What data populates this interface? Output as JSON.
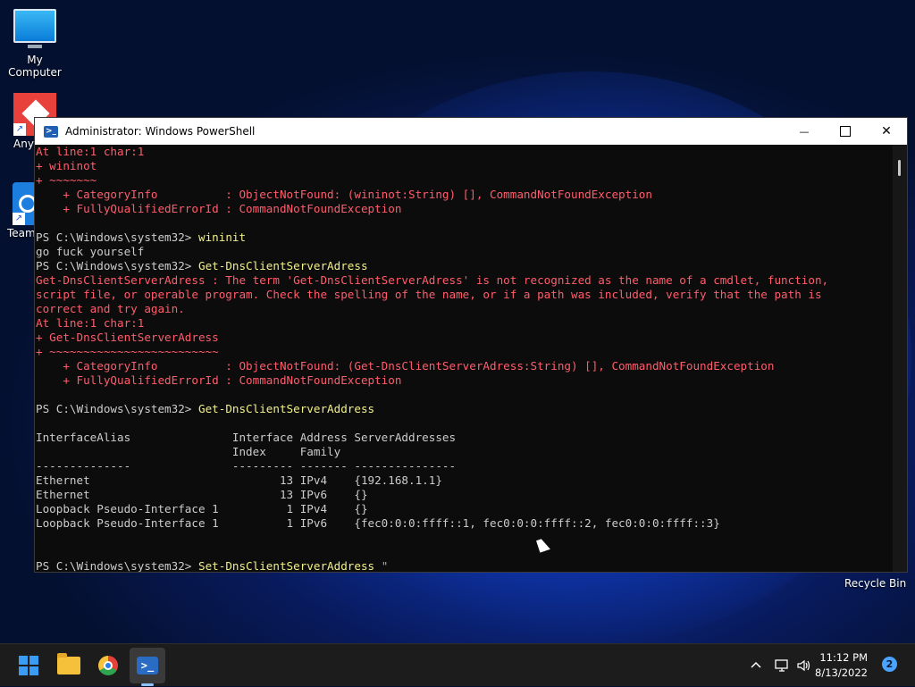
{
  "desktop": {
    "icons": [
      {
        "label": "My Computer"
      },
      {
        "label": "Any"
      },
      {
        "label": "Team"
      }
    ],
    "recycle_bin": "Recycle Bin"
  },
  "window": {
    "title": "Administrator: Windows PowerShell",
    "controls": {
      "minimize": "—",
      "close": "✕"
    }
  },
  "console": {
    "lines": [
      {
        "text": "At line:1 char:1",
        "style": "err"
      },
      {
        "text": "+ wininot",
        "style": "err"
      },
      {
        "text": "+ ~~~~~~~",
        "style": "err"
      },
      {
        "text": "    + CategoryInfo          : ObjectNotFound: (wininot:String) [], CommandNotFoundException",
        "style": "err"
      },
      {
        "text": "    + FullyQualifiedErrorId : CommandNotFoundException",
        "style": "err"
      },
      {
        "text": "",
        "style": "out"
      },
      {
        "prompt": "PS C:\\Windows\\system32> ",
        "cmd": "wininit"
      },
      {
        "text": "go fuck yourself",
        "style": "out"
      },
      {
        "prompt": "PS C:\\Windows\\system32> ",
        "cmd": "Get-DnsClientServerAdress"
      },
      {
        "text": "Get-DnsClientServerAdress : The term 'Get-DnsClientServerAdress' is not recognized as the name of a cmdlet, function,",
        "style": "err"
      },
      {
        "text": "script file, or operable program. Check the spelling of the name, or if a path was included, verify that the path is",
        "style": "err"
      },
      {
        "text": "correct and try again.",
        "style": "err"
      },
      {
        "text": "At line:1 char:1",
        "style": "err"
      },
      {
        "text": "+ Get-DnsClientServerAdress",
        "style": "err"
      },
      {
        "text": "+ ~~~~~~~~~~~~~~~~~~~~~~~~~",
        "style": "err"
      },
      {
        "text": "    + CategoryInfo          : ObjectNotFound: (Get-DnsClientServerAdress:String) [], CommandNotFoundException",
        "style": "err"
      },
      {
        "text": "    + FullyQualifiedErrorId : CommandNotFoundException",
        "style": "err"
      },
      {
        "text": "",
        "style": "out"
      },
      {
        "prompt": "PS C:\\Windows\\system32> ",
        "cmd": "Get-DnsClientServerAddress"
      },
      {
        "text": "",
        "style": "out"
      },
      {
        "text": "InterfaceAlias               Interface Address ServerAddresses",
        "style": "out"
      },
      {
        "text": "                             Index     Family",
        "style": "out"
      },
      {
        "text": "--------------               --------- ------- ---------------",
        "style": "out"
      },
      {
        "text": "Ethernet                            13 IPv4    {192.168.1.1}",
        "style": "out"
      },
      {
        "text": "Ethernet                            13 IPv6    {}",
        "style": "out"
      },
      {
        "text": "Loopback Pseudo-Interface 1          1 IPv4    {}",
        "style": "out"
      },
      {
        "text": "Loopback Pseudo-Interface 1          1 IPv6    {fec0:0:0:ffff::1, fec0:0:0:ffff::2, fec0:0:0:ffff::3}",
        "style": "out"
      },
      {
        "text": "",
        "style": "out"
      },
      {
        "text": "",
        "style": "out"
      },
      {
        "prompt": "PS C:\\Windows\\system32> ",
        "cmd": "Set-DnsClientServerAddress ",
        "tail": "\""
      }
    ]
  },
  "taskbar": {
    "clock_time": "11:12 PM",
    "clock_date": "8/13/2022",
    "notification_count": "2",
    "tray_icons": [
      "chevron-up-icon",
      "network-icon",
      "volume-icon"
    ]
  },
  "colors": {
    "console_bg": "#0c0c0c",
    "error_text": "#ff5d6c",
    "command_text": "#f2f08a",
    "normal_text": "#cccccc"
  }
}
